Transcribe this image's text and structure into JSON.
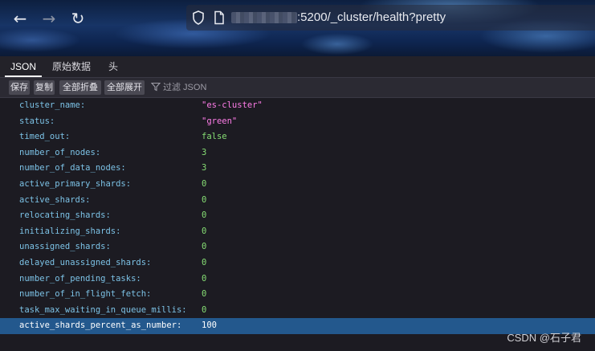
{
  "browser": {
    "url_text": ":5200/_cluster/health?pretty",
    "icons": [
      "back-arrow-icon",
      "forward-arrow-icon",
      "reload-icon",
      "shield-icon",
      "page-icon"
    ]
  },
  "tabs": [
    {
      "label": "JSON",
      "active": true
    },
    {
      "label": "原始数据",
      "active": false
    },
    {
      "label": "头",
      "active": false
    }
  ],
  "toolbar": {
    "save": "保存",
    "copy": "复制",
    "collapse_all": "全部折叠",
    "expand_all": "全部展开",
    "filter_placeholder": "过滤 JSON"
  },
  "rows": [
    {
      "key": "cluster_name:",
      "value": "\"es-cluster\"",
      "type": "str"
    },
    {
      "key": "status:",
      "value": "\"green\"",
      "type": "str"
    },
    {
      "key": "timed_out:",
      "value": "false",
      "type": "bool"
    },
    {
      "key": "number_of_nodes:",
      "value": "3",
      "type": "num"
    },
    {
      "key": "number_of_data_nodes:",
      "value": "3",
      "type": "num"
    },
    {
      "key": "active_primary_shards:",
      "value": "0",
      "type": "num"
    },
    {
      "key": "active_shards:",
      "value": "0",
      "type": "num"
    },
    {
      "key": "relocating_shards:",
      "value": "0",
      "type": "num"
    },
    {
      "key": "initializing_shards:",
      "value": "0",
      "type": "num"
    },
    {
      "key": "unassigned_shards:",
      "value": "0",
      "type": "num"
    },
    {
      "key": "delayed_unassigned_shards:",
      "value": "0",
      "type": "num"
    },
    {
      "key": "number_of_pending_tasks:",
      "value": "0",
      "type": "num"
    },
    {
      "key": "number_of_in_flight_fetch:",
      "value": "0",
      "type": "num"
    },
    {
      "key": "task_max_waiting_in_queue_millis:",
      "value": "0",
      "type": "num"
    },
    {
      "key": "active_shards_percent_as_number:",
      "value": "100",
      "type": "num",
      "selected": true
    }
  ],
  "watermark": "CSDN @石子君",
  "colors": {
    "key": "#7cc2e6",
    "string": "#ff7de9",
    "number": "#86de74",
    "selected_row": "#23588d"
  }
}
